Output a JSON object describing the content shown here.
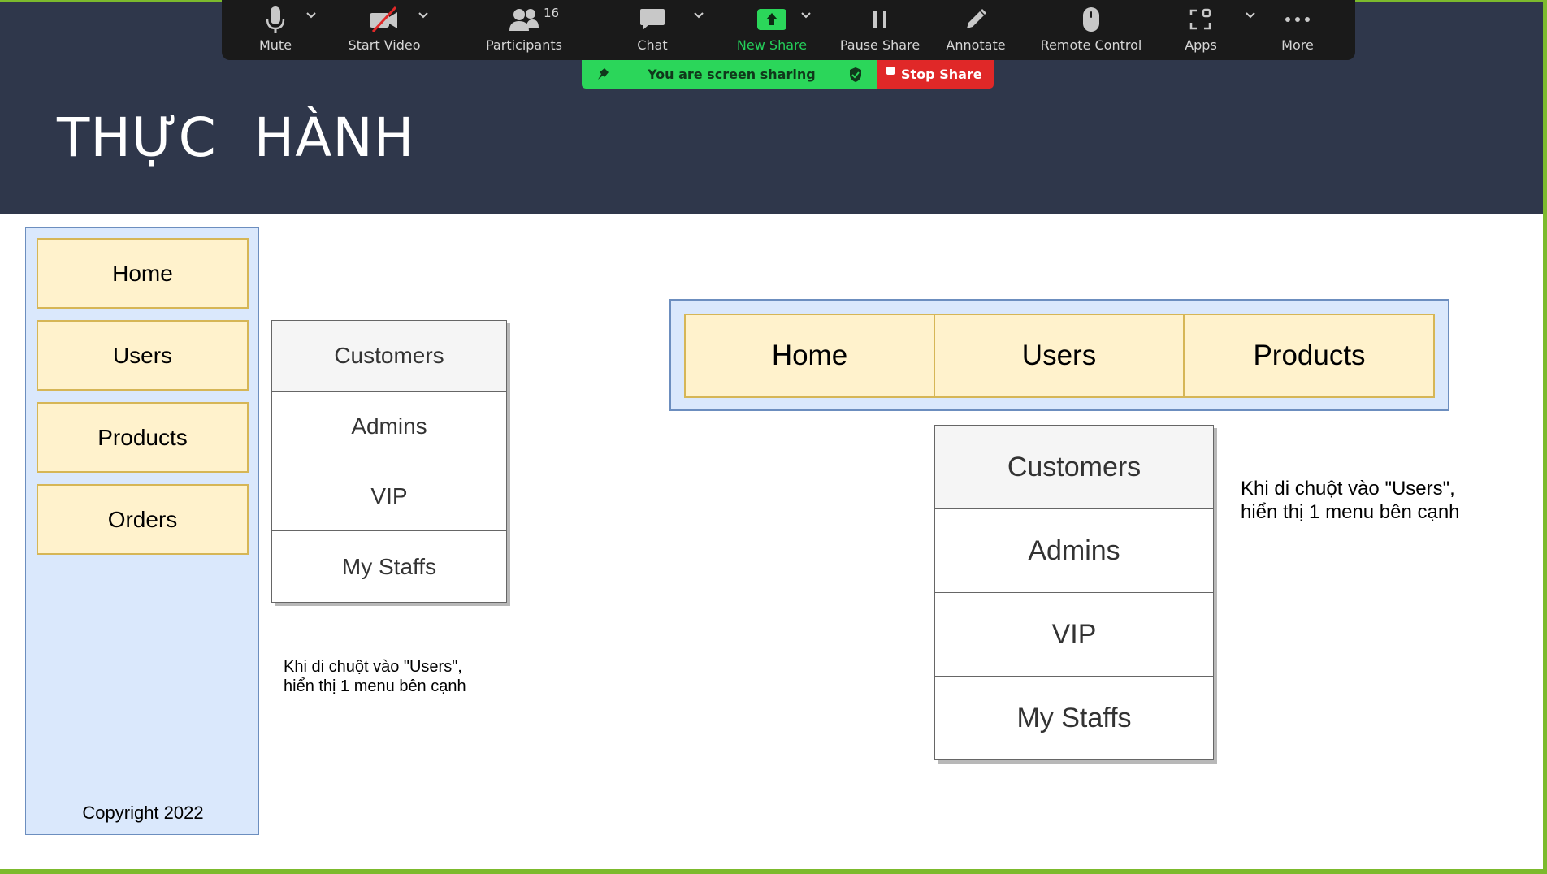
{
  "toolbar": {
    "items": [
      {
        "label": "Mute",
        "icon": "microphone-icon"
      },
      {
        "label": "Start Video",
        "icon": "video-off-icon"
      },
      {
        "label": "Participants",
        "icon": "participants-icon",
        "count": "16"
      },
      {
        "label": "Chat",
        "icon": "chat-icon"
      },
      {
        "label": "New Share",
        "icon": "share-screen-icon"
      },
      {
        "label": "Pause Share",
        "icon": "pause-icon"
      },
      {
        "label": "Annotate",
        "icon": "pencil-icon"
      },
      {
        "label": "Remote Control",
        "icon": "mouse-icon"
      },
      {
        "label": "Apps",
        "icon": "apps-icon"
      },
      {
        "label": "More",
        "icon": "more-dots-icon"
      }
    ],
    "sharing_status": "You are screen sharing",
    "stop_share": "Stop Share",
    "colors": {
      "background": "#1a1a1a",
      "share_green": "#2bd65a",
      "stop_red": "#e02828"
    }
  },
  "slide": {
    "title": "THỰC HÀNH",
    "colors": {
      "header": "#2f374b",
      "menu_fill": "#fff2cc",
      "menu_border": "#d6b656",
      "panel_fill": "#dae8fc",
      "panel_border": "#6c8ebf",
      "frame": "#7cba2d"
    }
  },
  "sidebar": {
    "items": [
      "Home",
      "Users",
      "Products",
      "Orders"
    ],
    "copyright": "Copyright 2022"
  },
  "submenu_left": {
    "items": [
      "Customers",
      "Admins",
      "VIP",
      "My Staffs"
    ],
    "note_line1": "Khi di chuột vào \"Users\",",
    "note_line2": "hiển thị 1 menu bên cạnh"
  },
  "topnav": {
    "items": [
      "Home",
      "Users",
      "Products"
    ]
  },
  "submenu_right": {
    "items": [
      "Customers",
      "Admins",
      "VIP",
      "My Staffs"
    ],
    "note_line1": "Khi di chuột vào \"Users\",",
    "note_line2": "hiển thị 1 menu bên cạnh"
  }
}
